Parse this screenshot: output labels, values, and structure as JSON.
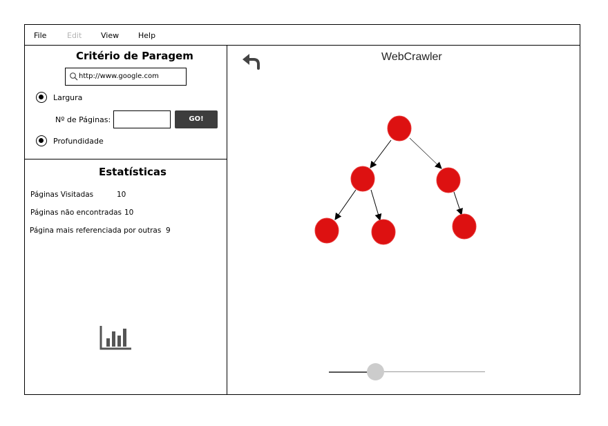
{
  "menu": {
    "file": "File",
    "edit": "Edit",
    "view": "View",
    "help": "Help"
  },
  "criteria": {
    "title": "Critério de Paragem",
    "search_value": "http://www.google.com",
    "breadth_label": "Largura",
    "depth_label": "Profundidade",
    "pages_label": "Nº de Páginas:",
    "pages_value": "",
    "go_label": "GO!"
  },
  "stats": {
    "title": "Estatísticas",
    "rows": [
      {
        "label": "Páginas Visitadas",
        "value": "10"
      },
      {
        "label": "Páginas não encontradas",
        "value": "10"
      },
      {
        "label": "Página mais referenciada por outras",
        "value": "9"
      }
    ]
  },
  "main": {
    "title": "WebCrawler"
  },
  "slider": {
    "value": 0.3
  },
  "colors": {
    "node": "#dd1111",
    "node_border": "#e83535",
    "button": "#3d3d3d"
  },
  "icons": {
    "back": "undo-arrow-icon",
    "search": "search-icon",
    "stats": "bar-chart-icon"
  }
}
